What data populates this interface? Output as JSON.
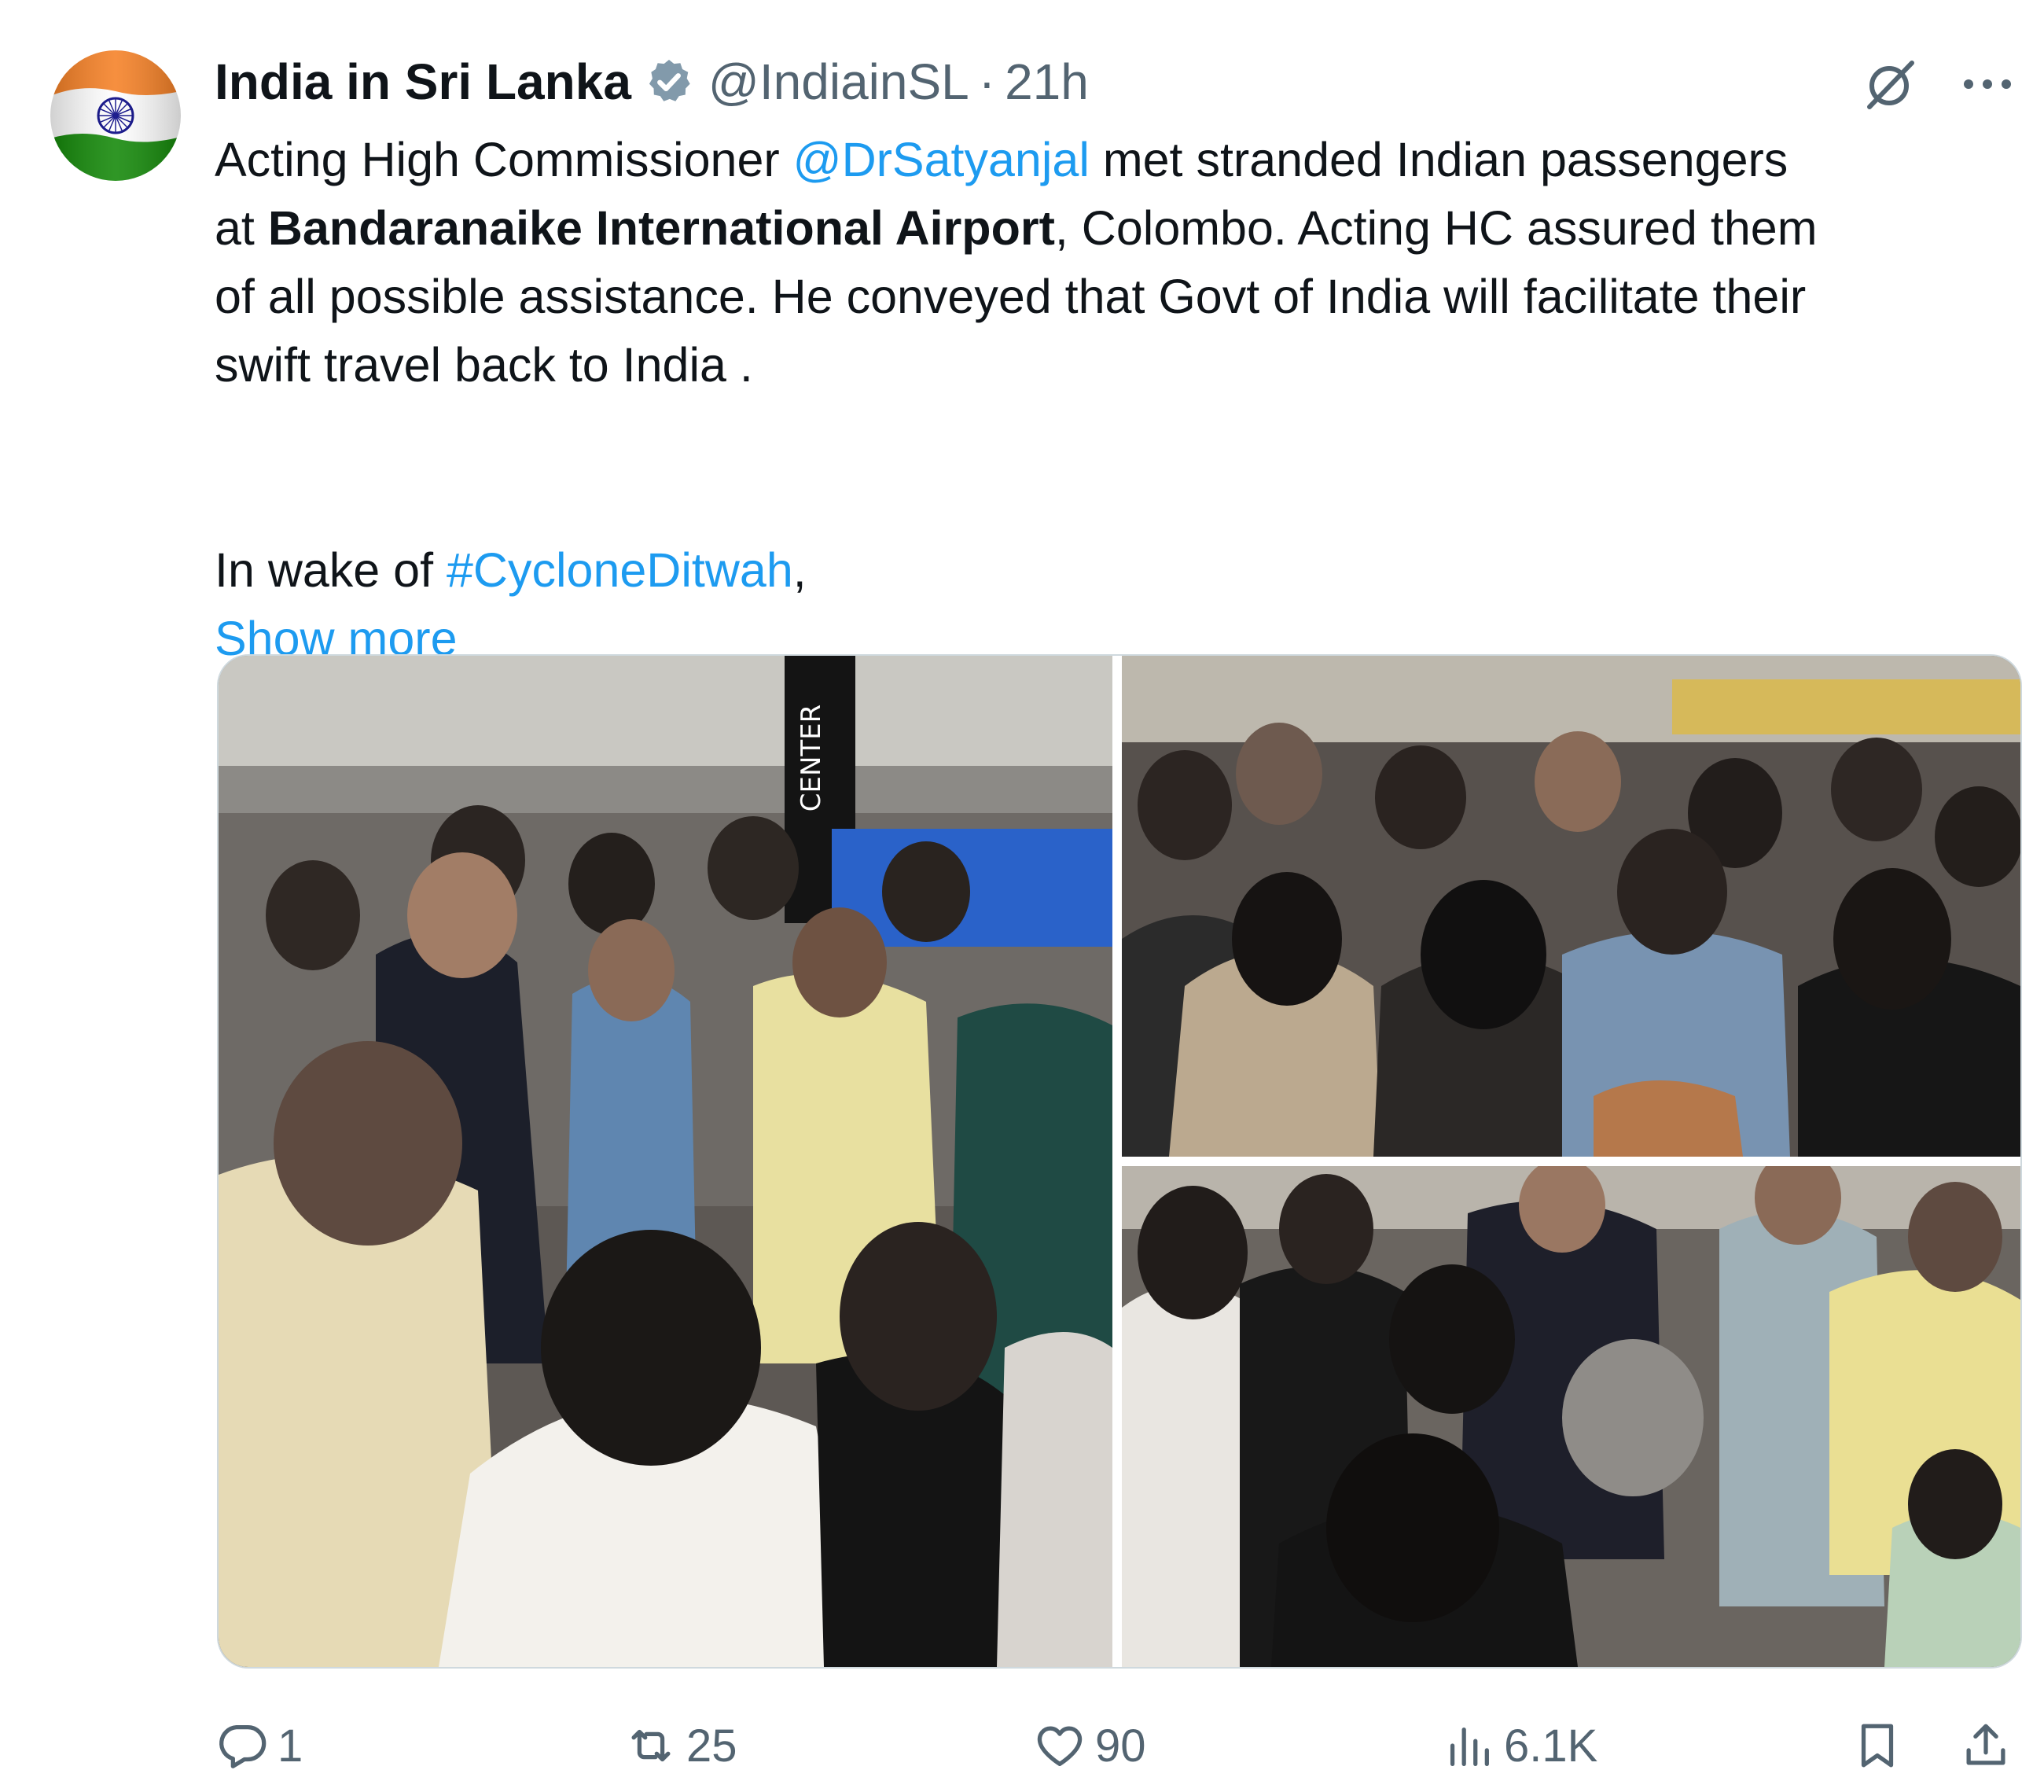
{
  "tweet": {
    "display_name": "India in Sri Lanka",
    "handle": "@IndiainSL",
    "separator": "·",
    "time": "21h",
    "text": {
      "line1_a": "Acting High Commissioner ",
      "line1_mention": "@DrSatyanjal",
      "line1_b": " met stranded Indian passengers",
      "line2_a": "at ",
      "line2_bold": "Bandaranaike International Airport",
      "line2_b": ", Colombo. Acting HC assured them",
      "line3": "of all possible assistance. He conveyed that Govt of India will facilitate their",
      "line4": "swift travel back to India .",
      "line5_a": "In wake of ",
      "line5_hashtag": "#CycloneDitwah",
      "line5_b": ",",
      "show_more": "Show more"
    },
    "photo_sign_text": "CENTER",
    "actions": {
      "reply_count": "1",
      "retweet_count": "25",
      "like_count": "90",
      "views_count": "6.1K"
    }
  },
  "icons": {
    "avatar": "india-flag-avatar",
    "verified": "verified-badge-icon",
    "grok": "grok-icon",
    "more": "more-icon",
    "reply": "reply-icon",
    "retweet": "retweet-icon",
    "like": "heart-icon",
    "views": "views-icon",
    "bookmark": "bookmark-icon",
    "share": "share-icon"
  },
  "colors": {
    "link": "#1d9bf0",
    "text": "#0f1419",
    "muted": "#536471",
    "verified": "#829aab",
    "saffron": "#f58025",
    "green": "#138808",
    "chakra": "#000080"
  }
}
